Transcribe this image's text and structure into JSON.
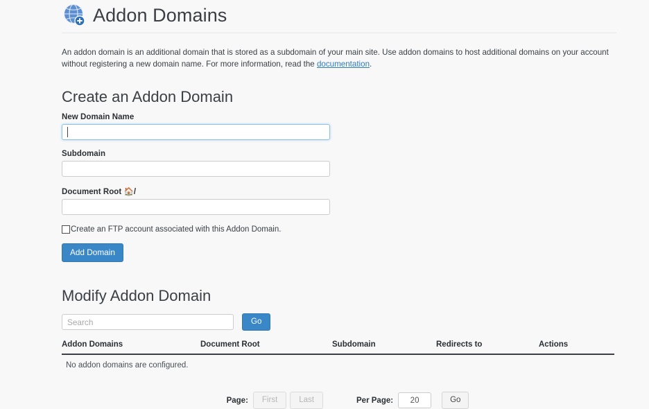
{
  "header": {
    "title": "Addon Domains",
    "icon": "globe-plus-icon"
  },
  "description": {
    "text_before_link": "An addon domain is an additional domain that is stored as a subdomain of your main site. Use addon domains to host additional domains on your account without registering a new domain name. For more information, read the ",
    "link_text": "documentation",
    "text_after_link": "."
  },
  "create_section": {
    "title": "Create an Addon Domain",
    "fields": [
      {
        "label": "New Domain Name",
        "value": "",
        "placeholder": "",
        "focused": true
      },
      {
        "label": "Subdomain",
        "value": "",
        "placeholder": "",
        "focused": false
      },
      {
        "label": "Document Root ",
        "label_suffix": "/",
        "value": "",
        "placeholder": "",
        "focused": false
      }
    ],
    "checkbox_label": "Create an FTP account associated with this Addon Domain.",
    "checkbox_checked": false,
    "submit_label": "Add Domain"
  },
  "modify_section": {
    "title": "Modify Addon Domain",
    "search_placeholder": "Search",
    "search_value": "",
    "search_go_label": "Go",
    "table": {
      "columns": [
        "Addon Domains",
        "Document Root",
        "Subdomain",
        "Redirects to",
        "Actions"
      ],
      "rows": [],
      "empty_message": "No addon domains are configured."
    }
  },
  "pagination": {
    "page_label": "Page:",
    "first_label": "First",
    "last_label": "Last",
    "per_page_label": "Per Page:",
    "per_page_value": "20",
    "go_label": "Go"
  },
  "colors": {
    "accent": "#3a87c8",
    "link": "#2f7bbf",
    "background": "#f8f8f8",
    "text": "#3a3f44"
  }
}
